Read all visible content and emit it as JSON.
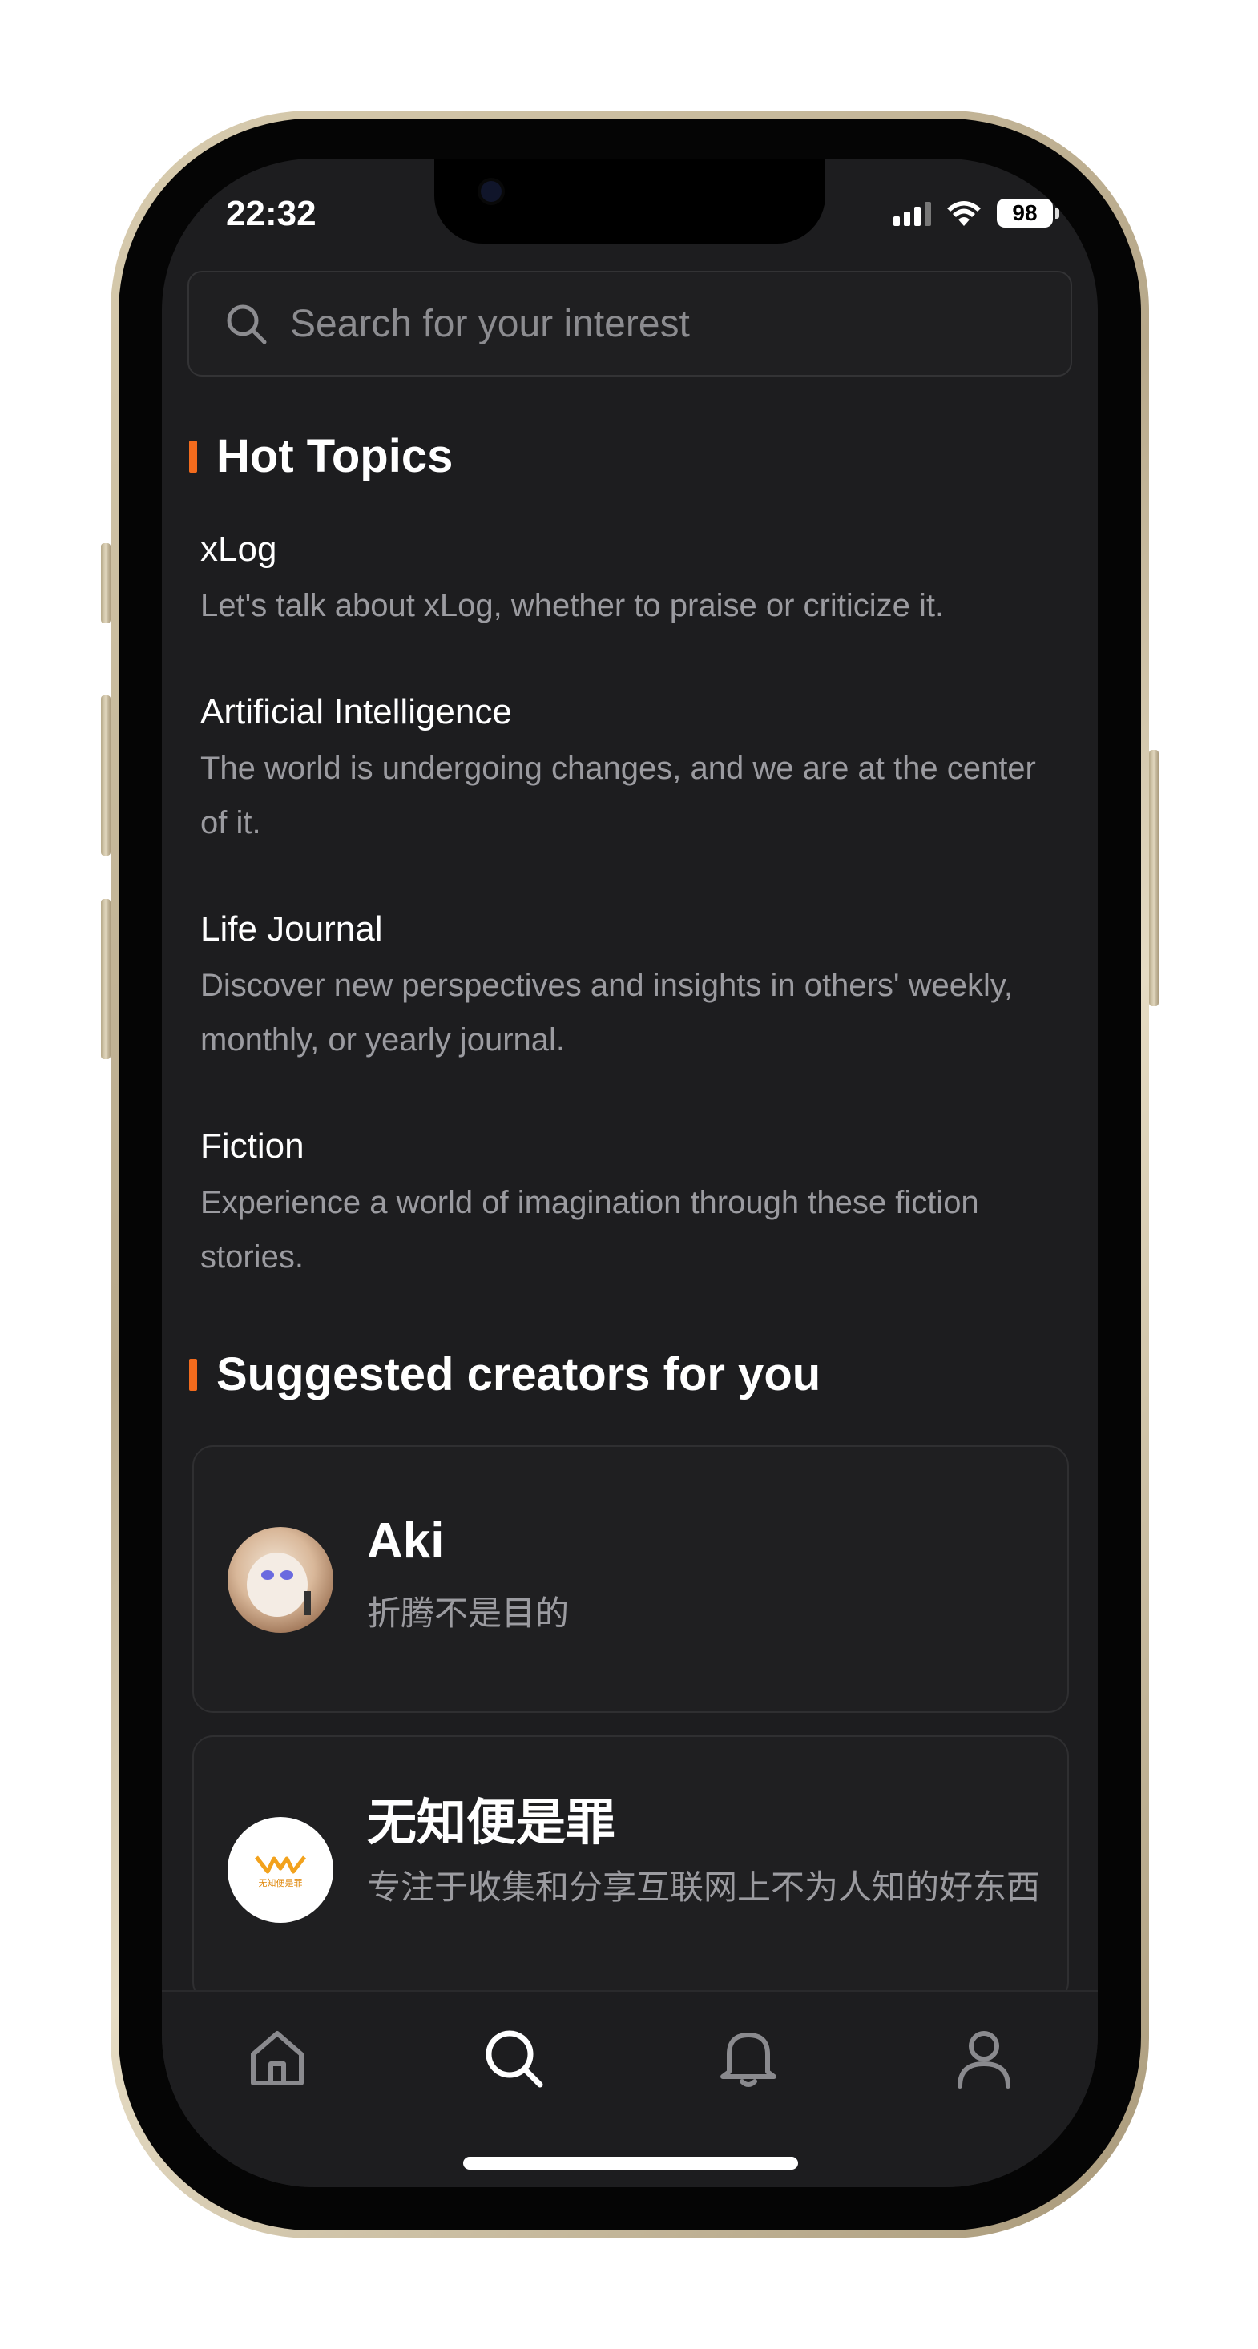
{
  "status_bar": {
    "time": "22:32",
    "battery": "98"
  },
  "search": {
    "placeholder": "Search for your interest"
  },
  "hot_topics": {
    "title": "Hot Topics",
    "items": [
      {
        "title": "xLog",
        "description": "Let's talk about xLog, whether to praise or criticize it."
      },
      {
        "title": "Artificial Intelligence",
        "description": "The world is undergoing changes, and we are at the center of it."
      },
      {
        "title": "Life Journal",
        "description": "Discover new perspectives and insights in others' weekly, monthly, or yearly journal."
      },
      {
        "title": "Fiction",
        "description": "Experience a world of imagination through these fiction stories."
      }
    ]
  },
  "suggested_creators": {
    "title": "Suggested creators for you",
    "items": [
      {
        "name": "Aki",
        "bio": "折腾不是目的"
      },
      {
        "name": "无知便是罪",
        "bio": "专注于收集和分享互联网上不为人知的好东西",
        "logo_text": "无知便是罪"
      }
    ]
  },
  "tabbar": {
    "icons": [
      "home-icon",
      "search-icon",
      "bell-icon",
      "user-icon"
    ],
    "active": "search-icon"
  },
  "colors": {
    "accent": "#f26b1d",
    "background": "#1d1d1f",
    "text": "#ffffff",
    "muted": "#9b9ba0"
  }
}
